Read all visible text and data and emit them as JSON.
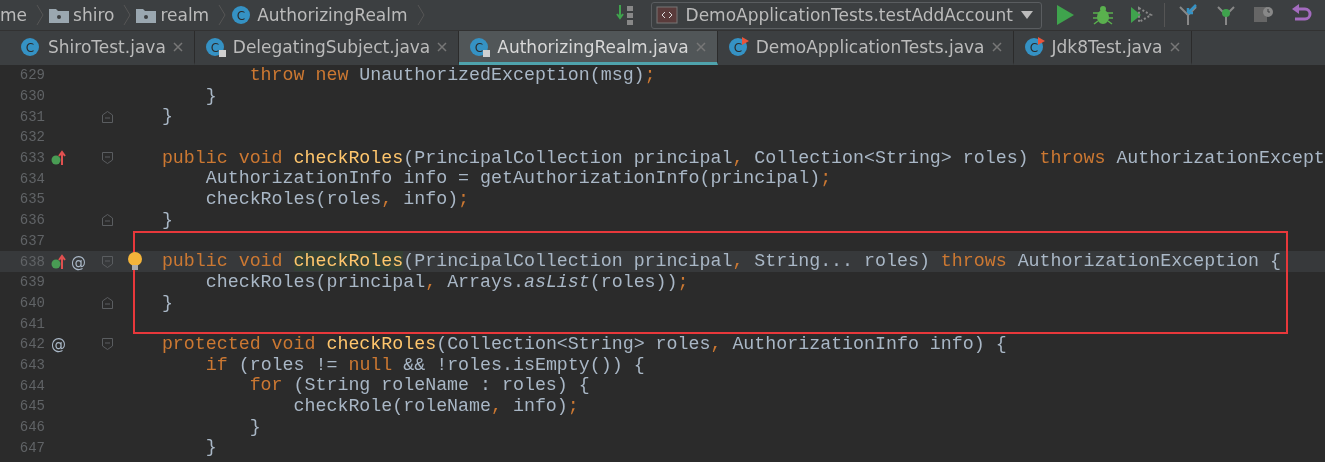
{
  "breadcrumbs": [
    {
      "kind": "text",
      "label": "me"
    },
    {
      "kind": "package",
      "label": "shiro"
    },
    {
      "kind": "package",
      "label": "realm"
    },
    {
      "kind": "class",
      "label": "AuthorizingRealm",
      "icon_letter": "C"
    }
  ],
  "toolbar": {
    "run_config": "DemoApplicationTests.testAddAccount"
  },
  "tabs": [
    {
      "label": "ShiroTest.java",
      "kind": "plain",
      "icon_letter": "C",
      "selected": false
    },
    {
      "label": "DelegatingSubject.java",
      "kind": "locked",
      "icon_letter": "C",
      "selected": false
    },
    {
      "label": "AuthorizingRealm.java",
      "kind": "locked",
      "icon_letter": "C",
      "selected": true
    },
    {
      "label": "DemoApplicationTests.java",
      "kind": "runnable",
      "icon_letter": "C",
      "selected": false
    },
    {
      "label": "Jdk8Test.java",
      "kind": "runnable",
      "icon_letter": "C",
      "selected": false
    }
  ],
  "editor": {
    "lines": [
      {
        "number": "629",
        "override": false,
        "fold_start": false,
        "fold_end": false,
        "bulb": false,
        "current": false,
        "framed": false,
        "tokens": [
          {
            "kind": "keyword",
            "text": "            throw new"
          },
          {
            "kind": "plain",
            "text": " UnauthorizedException(msg)"
          },
          {
            "kind": "punct",
            "text": ";"
          }
        ]
      },
      {
        "number": "630",
        "override": false,
        "fold_start": false,
        "fold_end": false,
        "bulb": false,
        "current": false,
        "framed": false,
        "tokens": [
          {
            "kind": "plain",
            "text": "        }"
          }
        ]
      },
      {
        "number": "631",
        "override": false,
        "fold_start": false,
        "fold_end": true,
        "bulb": false,
        "current": false,
        "framed": false,
        "tokens": [
          {
            "kind": "plain",
            "text": "    }"
          }
        ]
      },
      {
        "number": "632",
        "override": false,
        "fold_start": false,
        "fold_end": false,
        "bulb": false,
        "current": false,
        "framed": false
      },
      {
        "number": "633",
        "override": true,
        "fold_start": true,
        "fold_end": false,
        "bulb": false,
        "current": false,
        "framed": false,
        "tokens": [
          {
            "kind": "keyword",
            "text": "    public void "
          },
          {
            "kind": "decl",
            "text": "checkRoles"
          },
          {
            "kind": "plain",
            "text": "(PrincipalCollection principal"
          },
          {
            "kind": "punct",
            "text": ","
          },
          {
            "kind": "plain",
            "text": " Collection<String> roles) "
          },
          {
            "kind": "keyword",
            "text": "throws"
          },
          {
            "kind": "plain",
            "text": " AuthorizationExcept"
          }
        ]
      },
      {
        "number": "634",
        "override": false,
        "fold_start": false,
        "fold_end": false,
        "bulb": false,
        "current": false,
        "framed": false,
        "tokens": [
          {
            "kind": "plain",
            "text": "        AuthorizationInfo info = getAuthorizationInfo(principal)"
          },
          {
            "kind": "punct",
            "text": ";"
          }
        ]
      },
      {
        "number": "635",
        "override": false,
        "fold_start": false,
        "fold_end": false,
        "bulb": false,
        "current": false,
        "framed": false,
        "tokens": [
          {
            "kind": "plain",
            "text": "        checkRoles(roles"
          },
          {
            "kind": "punct",
            "text": ","
          },
          {
            "kind": "plain",
            "text": " info)"
          },
          {
            "kind": "punct",
            "text": ";"
          }
        ]
      },
      {
        "number": "636",
        "override": false,
        "fold_start": false,
        "fold_end": true,
        "bulb": false,
        "current": false,
        "framed": false,
        "tokens": [
          {
            "kind": "plain",
            "text": "    }"
          }
        ]
      },
      {
        "number": "637",
        "override": false,
        "fold_start": false,
        "fold_end": false,
        "bulb": false,
        "current": false,
        "framed": true
      },
      {
        "number": "638",
        "override": true,
        "mark": "@",
        "fold_start": true,
        "fold_end": false,
        "bulb": true,
        "current": true,
        "framed": true,
        "tokens": [
          {
            "kind": "keyword",
            "text": "    public void "
          },
          {
            "kind": "decl-hl",
            "text": "checkRoles"
          },
          {
            "kind": "plain",
            "text": "(PrincipalCollection principal"
          },
          {
            "kind": "punct",
            "text": ","
          },
          {
            "kind": "plain",
            "text": " String... roles) "
          },
          {
            "kind": "keyword",
            "text": "throws"
          },
          {
            "kind": "plain",
            "text": " AuthorizationException {"
          }
        ]
      },
      {
        "number": "639",
        "override": false,
        "fold_start": false,
        "fold_end": false,
        "bulb": false,
        "current": false,
        "framed": true,
        "tokens": [
          {
            "kind": "plain",
            "text": "        checkRoles(principal"
          },
          {
            "kind": "punct",
            "text": ","
          },
          {
            "kind": "plain",
            "text": " Arrays."
          },
          {
            "kind": "italic",
            "text": "asList"
          },
          {
            "kind": "plain",
            "text": "(roles))"
          },
          {
            "kind": "punct",
            "text": ";"
          }
        ]
      },
      {
        "number": "640",
        "override": false,
        "fold_start": false,
        "fold_end": true,
        "bulb": false,
        "current": false,
        "framed": true,
        "tokens": [
          {
            "kind": "plain",
            "text": "    }"
          }
        ]
      },
      {
        "number": "641",
        "override": false,
        "fold_start": false,
        "fold_end": false,
        "bulb": false,
        "current": false,
        "framed": true
      },
      {
        "number": "642",
        "override": false,
        "mark": "@",
        "fold_start": true,
        "fold_end": false,
        "bulb": false,
        "current": false,
        "framed": false,
        "tokens": [
          {
            "kind": "keyword",
            "text": "    protected void "
          },
          {
            "kind": "decl",
            "text": "checkRoles"
          },
          {
            "kind": "plain",
            "text": "(Collection<String> roles"
          },
          {
            "kind": "punct",
            "text": ","
          },
          {
            "kind": "plain",
            "text": " AuthorizationInfo info) {"
          }
        ]
      },
      {
        "number": "643",
        "override": false,
        "fold_start": false,
        "fold_end": false,
        "bulb": false,
        "current": false,
        "framed": false,
        "tokens": [
          {
            "kind": "keyword",
            "text": "        if"
          },
          {
            "kind": "plain",
            "text": " (roles != "
          },
          {
            "kind": "keyword",
            "text": "null"
          },
          {
            "kind": "plain",
            "text": " && !roles.isEmpty()) {"
          }
        ]
      },
      {
        "number": "644",
        "override": false,
        "fold_start": false,
        "fold_end": false,
        "bulb": false,
        "current": false,
        "framed": false,
        "tokens": [
          {
            "kind": "keyword",
            "text": "            for"
          },
          {
            "kind": "plain",
            "text": " (String roleName : roles) {"
          }
        ]
      },
      {
        "number": "645",
        "override": false,
        "fold_start": false,
        "fold_end": false,
        "bulb": false,
        "current": false,
        "framed": false,
        "tokens": [
          {
            "kind": "plain",
            "text": "                checkRole(roleName"
          },
          {
            "kind": "punct",
            "text": ","
          },
          {
            "kind": "plain",
            "text": " info)"
          },
          {
            "kind": "punct",
            "text": ";"
          }
        ]
      },
      {
        "number": "646",
        "override": false,
        "fold_start": false,
        "fold_end": false,
        "bulb": false,
        "current": false,
        "framed": false,
        "tokens": [
          {
            "kind": "plain",
            "text": "            }"
          }
        ]
      },
      {
        "number": "647",
        "override": false,
        "fold_start": false,
        "fold_end": false,
        "bulb": false,
        "current": false,
        "framed": false,
        "tokens": [
          {
            "kind": "plain",
            "text": "        }"
          }
        ]
      }
    ]
  }
}
